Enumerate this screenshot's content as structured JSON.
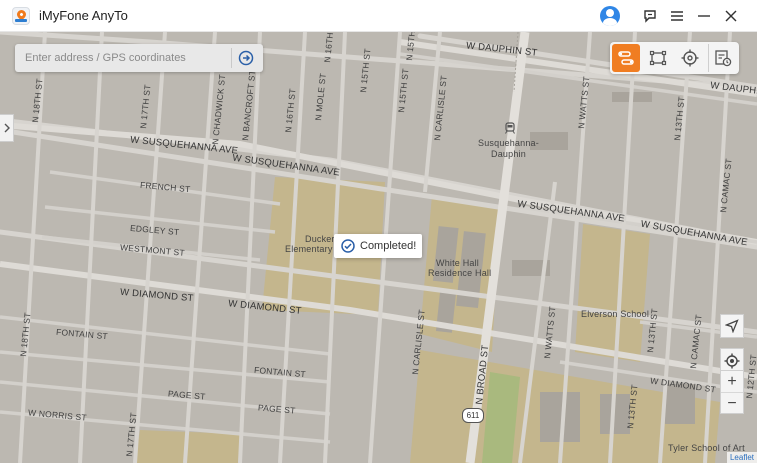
{
  "app": {
    "title": "iMyFone AnyTo",
    "colors": {
      "accent": "#f07d22",
      "avatar": "#2f86e6",
      "map_bg": "#bcb8b1",
      "park": "#c4b68d"
    },
    "icons": [
      "app-logo-icon",
      "account-icon",
      "feedback-icon",
      "menu-icon",
      "minimize-icon",
      "close-icon"
    ]
  },
  "search": {
    "placeholder": "Enter address / GPS coordinates",
    "value": "",
    "go_icon": "arrow-right-circle-icon"
  },
  "modes": {
    "items": [
      {
        "name": "two-spot-mode",
        "icon": "route-icon",
        "active": true
      },
      {
        "name": "multi-spot-mode",
        "icon": "multi-point-icon",
        "active": false
      },
      {
        "name": "teleport-mode",
        "icon": "crosshair-icon",
        "active": false
      },
      {
        "name": "history-mode",
        "icon": "history-icon",
        "active": false
      }
    ]
  },
  "toast": {
    "text": "Completed!",
    "icon": "check-circle-icon"
  },
  "map": {
    "streets": {
      "w_dauphin": "W DAUPHIN ST",
      "w_dauphin_right": "W DAUPHIN S",
      "w_susquehanna": "W SUSQUEHANNA AVE",
      "w_susquehanna_mid": "W SUSQUEHANNA AVE",
      "w_susquehanna_right": "W SUSQUEHANNA AVE",
      "french": "FRENCH ST",
      "edgley": "EDGLEY ST",
      "westmont": "WESTMONT ST",
      "w_diamond": "W DIAMOND ST",
      "w_diamond2": "W DIAMOND ST",
      "w_diamond_right": "W DIAMOND ST",
      "fontain": "FONTAIN ST",
      "fontain2": "FONTAIN ST",
      "page": "PAGE ST",
      "page2": "PAGE ST",
      "w_norris": "W NORRIS ST",
      "n_18th": "N 18TH ST",
      "n_17th": "N 17TH ST",
      "n_chadwick": "N CHADWICK ST",
      "n_bancroft": "N BANCROFT ST",
      "n_16th": "N 16TH ST",
      "n_mole": "N MOLE ST",
      "n_15th": "N 15TH ST",
      "n_15th_b": "N 15TH ST",
      "n_carlisle": "N CARLISLE ST",
      "n_carlisle_b": "N CARLISLE ST",
      "n_watts": "N WATTS ST",
      "n_watts_b": "N WATTS ST",
      "n_13th": "N 13TH ST",
      "n_13th_b": "N 13TH ST",
      "n_camac": "N CAMAC ST",
      "n_camac_b": "N CAMAC ST",
      "n_12th": "N 12TH ST",
      "n_broad": "N BROAD ST",
      "n_17th_b": "N 17TH ST",
      "n_18th_b": "N 18TH ST",
      "n_16th_b": "N 16TH ST",
      "n_15th_c": "N 15TH ST",
      "n_13th_c": "N 13TH ST",
      "w_diamond_far": "W DIAMOND ST",
      "w_susquehanna_far": "W SUSQUEHANNA AVE"
    },
    "pois": {
      "station_a": "Susquehanna-",
      "station_b": "Dauphin",
      "ducker_a": "Ducker",
      "ducker_b": "Elementary",
      "whitehall_a": "White Hall",
      "whitehall_b": "Residence Hall",
      "elverson": "Elverson School",
      "tyler": "Tyler School of Art"
    },
    "shield": "611",
    "attribution": "Leaflet"
  },
  "controls": {
    "side_toggle_icon": "chevron-right-icon",
    "locate_icon": "navigation-arrow-icon",
    "center_icon": "target-icon",
    "zoom_in": "+",
    "zoom_out": "−"
  }
}
